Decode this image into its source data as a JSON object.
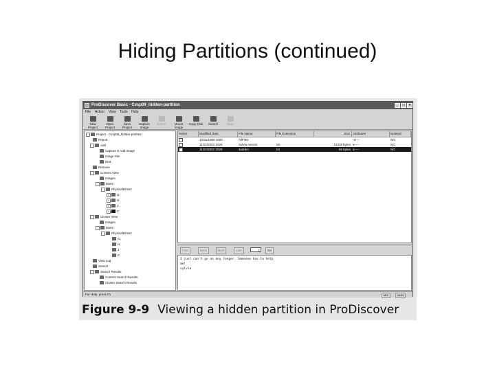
{
  "slide": {
    "title": "Hiding Partitions (continued)"
  },
  "window": {
    "title": "ProDiscover Basic - Cvsp09_hidden-partition"
  },
  "menu": [
    "File",
    "Action",
    "View",
    "Tools",
    "Help"
  ],
  "toolbar": [
    {
      "label": "New Project",
      "icon": "new-project-icon",
      "enabled": true
    },
    {
      "label": "Open Project",
      "icon": "open-project-icon",
      "enabled": true
    },
    {
      "label": "Save Project",
      "icon": "save-project-icon",
      "enabled": true
    },
    {
      "label": "Capture Image",
      "icon": "capture-image-icon",
      "enabled": true
    },
    {
      "label": "Export",
      "icon": "export-icon",
      "enabled": false
    },
    {
      "label": "Mount Image",
      "icon": "mount-image-icon",
      "enabled": true
    },
    {
      "label": "Copy Disk",
      "icon": "copy-disk-icon",
      "enabled": true
    },
    {
      "label": "Search",
      "icon": "search-icon",
      "enabled": true
    },
    {
      "label": "Stop",
      "icon": "stop-icon",
      "enabled": false
    }
  ],
  "tree": [
    {
      "label": "Project - Cvsp09_hidden-partition",
      "depth": 0,
      "icon": "project-icon"
    },
    {
      "label": "Report",
      "depth": 1,
      "icon": "report-icon"
    },
    {
      "label": "Add",
      "depth": 1,
      "icon": "add-icon"
    },
    {
      "label": "Capture & Add Image",
      "depth": 2,
      "icon": "capture-add-image-icon"
    },
    {
      "label": "Image File",
      "depth": 2,
      "icon": "image-file-icon"
    },
    {
      "label": "Disk",
      "depth": 2,
      "icon": "disk-icon"
    },
    {
      "label": "Remove",
      "depth": 1,
      "icon": "remove-icon"
    },
    {
      "label": "Content View",
      "depth": 1,
      "icon": "content-view-icon"
    },
    {
      "label": "Images",
      "depth": 2,
      "icon": "images-icon"
    },
    {
      "label": "Disks",
      "depth": 2,
      "icon": "disks-icon"
    },
    {
      "label": "PhysicalDrive2",
      "depth": 3,
      "icon": "physical-drive-icon"
    },
    {
      "label": "G:",
      "depth": 4,
      "icon": "drive-icon"
    },
    {
      "label": "H:",
      "depth": 4,
      "icon": "drive-icon"
    },
    {
      "label": "J:",
      "depth": 4,
      "icon": "drive-icon"
    },
    {
      "label": "Z:",
      "depth": 4,
      "icon": "drive-selected-icon"
    },
    {
      "label": "Cluster View",
      "depth": 1,
      "icon": "cluster-view-icon"
    },
    {
      "label": "Images",
      "depth": 2,
      "icon": "images-icon"
    },
    {
      "label": "Disks",
      "depth": 2,
      "icon": "disks-icon"
    },
    {
      "label": "PhysicalDrive2",
      "depth": 3,
      "icon": "physical-drive-icon"
    },
    {
      "label": "G:",
      "depth": 4,
      "icon": "drive-icon"
    },
    {
      "label": "H:",
      "depth": 4,
      "icon": "drive-icon"
    },
    {
      "label": "J:",
      "depth": 4,
      "icon": "drive-icon"
    },
    {
      "label": "Z:",
      "depth": 4,
      "icon": "drive-icon"
    },
    {
      "label": "View Log",
      "depth": 1,
      "icon": "view-log-icon"
    },
    {
      "label": "Search",
      "depth": 1,
      "icon": "search-icon"
    },
    {
      "label": "Search Results",
      "depth": 1,
      "icon": "search-results-icon"
    },
    {
      "label": "Content Search Results",
      "depth": 2,
      "icon": "content-search-results-icon"
    },
    {
      "label": "Cluster Search Results",
      "depth": 2,
      "icon": "cluster-search-results-icon"
    }
  ],
  "grid": {
    "columns": [
      "Select",
      "Modified Date",
      "File Name",
      "File Extension",
      "Size",
      "Attributes",
      "Deleted"
    ],
    "rows": [
      {
        "modified": "12/31/1969 1600",
        "name": "AllFiles",
        "ext": "",
        "size": "",
        "attr": "-d----",
        "deleted": "NO",
        "selected": false
      },
      {
        "modified": "11/22/2002 2028",
        "name": "Sylvia Aarons",
        "ext": "xls",
        "size": "14336 bytes",
        "attr": "a-----",
        "deleted": "NO",
        "selected": false
      },
      {
        "modified": "11/22/2002 2029",
        "name": "sudden",
        "ext": "txt",
        "size": "65 bytes",
        "attr": "a-----",
        "deleted": "NO",
        "selected": true
      }
    ]
  },
  "nav": {
    "first": "First",
    "back": "Back",
    "next": "Next",
    "last": "Last",
    "page": "1",
    "go": "Go"
  },
  "textpane": {
    "line1": "I just can't go on any longer. Someone has to help",
    "line2": "me!",
    "line3": "sylvia"
  },
  "status": {
    "left": "For Help, press F1",
    "mid": "MIX",
    "right": "NUM"
  },
  "caption": {
    "number": "Figure 9-9",
    "text": "Viewing a hidden partition in ProDiscover"
  }
}
